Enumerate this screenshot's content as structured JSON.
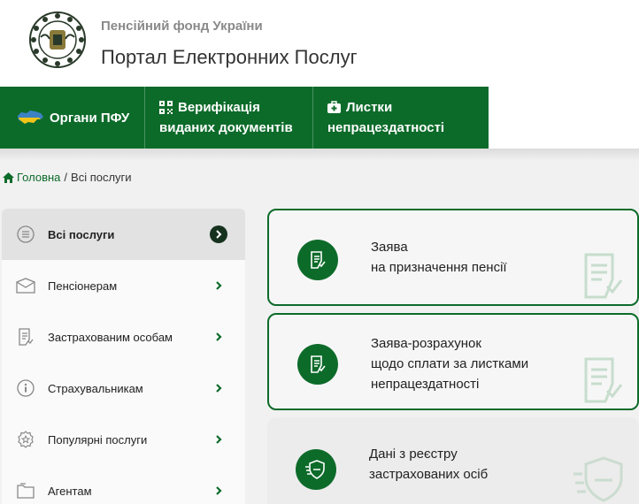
{
  "header": {
    "org_name": "Пенсійний фонд України",
    "portal_name": "Портал Електронних Послуг",
    "logo_icon": "pfu-emblem-icon"
  },
  "nav": {
    "items": [
      {
        "label": "Органи ПФУ",
        "icon": "ukraine-map-icon"
      },
      {
        "label_line1": "Верифікація",
        "label_line2": "виданих документів",
        "icon": "qr-code-icon"
      },
      {
        "label_line1": "Листки",
        "label_line2": "непрацездатності",
        "icon": "medical-kit-icon"
      }
    ]
  },
  "breadcrumb": {
    "home": "Головна",
    "separator": "/",
    "current": "Всі послуги"
  },
  "sidebar": {
    "items": [
      {
        "label": "Всі послуги",
        "icon": "list-icon",
        "active": true
      },
      {
        "label": "Пенсіонерам",
        "icon": "envelope-icon"
      },
      {
        "label": "Застрахованим особам",
        "icon": "document-icon"
      },
      {
        "label": "Страхувальникам",
        "icon": "info-icon"
      },
      {
        "label": "Популярні послуги",
        "icon": "badge-star-icon"
      },
      {
        "label": "Агентам",
        "icon": "folder-icon"
      }
    ]
  },
  "cards": [
    {
      "line1": "Заява",
      "line2": "на призначення пенсії",
      "icon": "application-form-icon"
    },
    {
      "line1": "Заява-розрахунок",
      "line2": "щодо сплати за листками",
      "line3": "непрацездатності",
      "icon": "application-form-icon"
    },
    {
      "line1": "Дані з реєстру",
      "line2": "застрахованих осіб",
      "icon": "shield-fast-icon"
    }
  ],
  "colors": {
    "brand_green": "#0d6b2a",
    "header_gray_text": "#8a8a8a",
    "page_background": "#f1f1f1"
  }
}
